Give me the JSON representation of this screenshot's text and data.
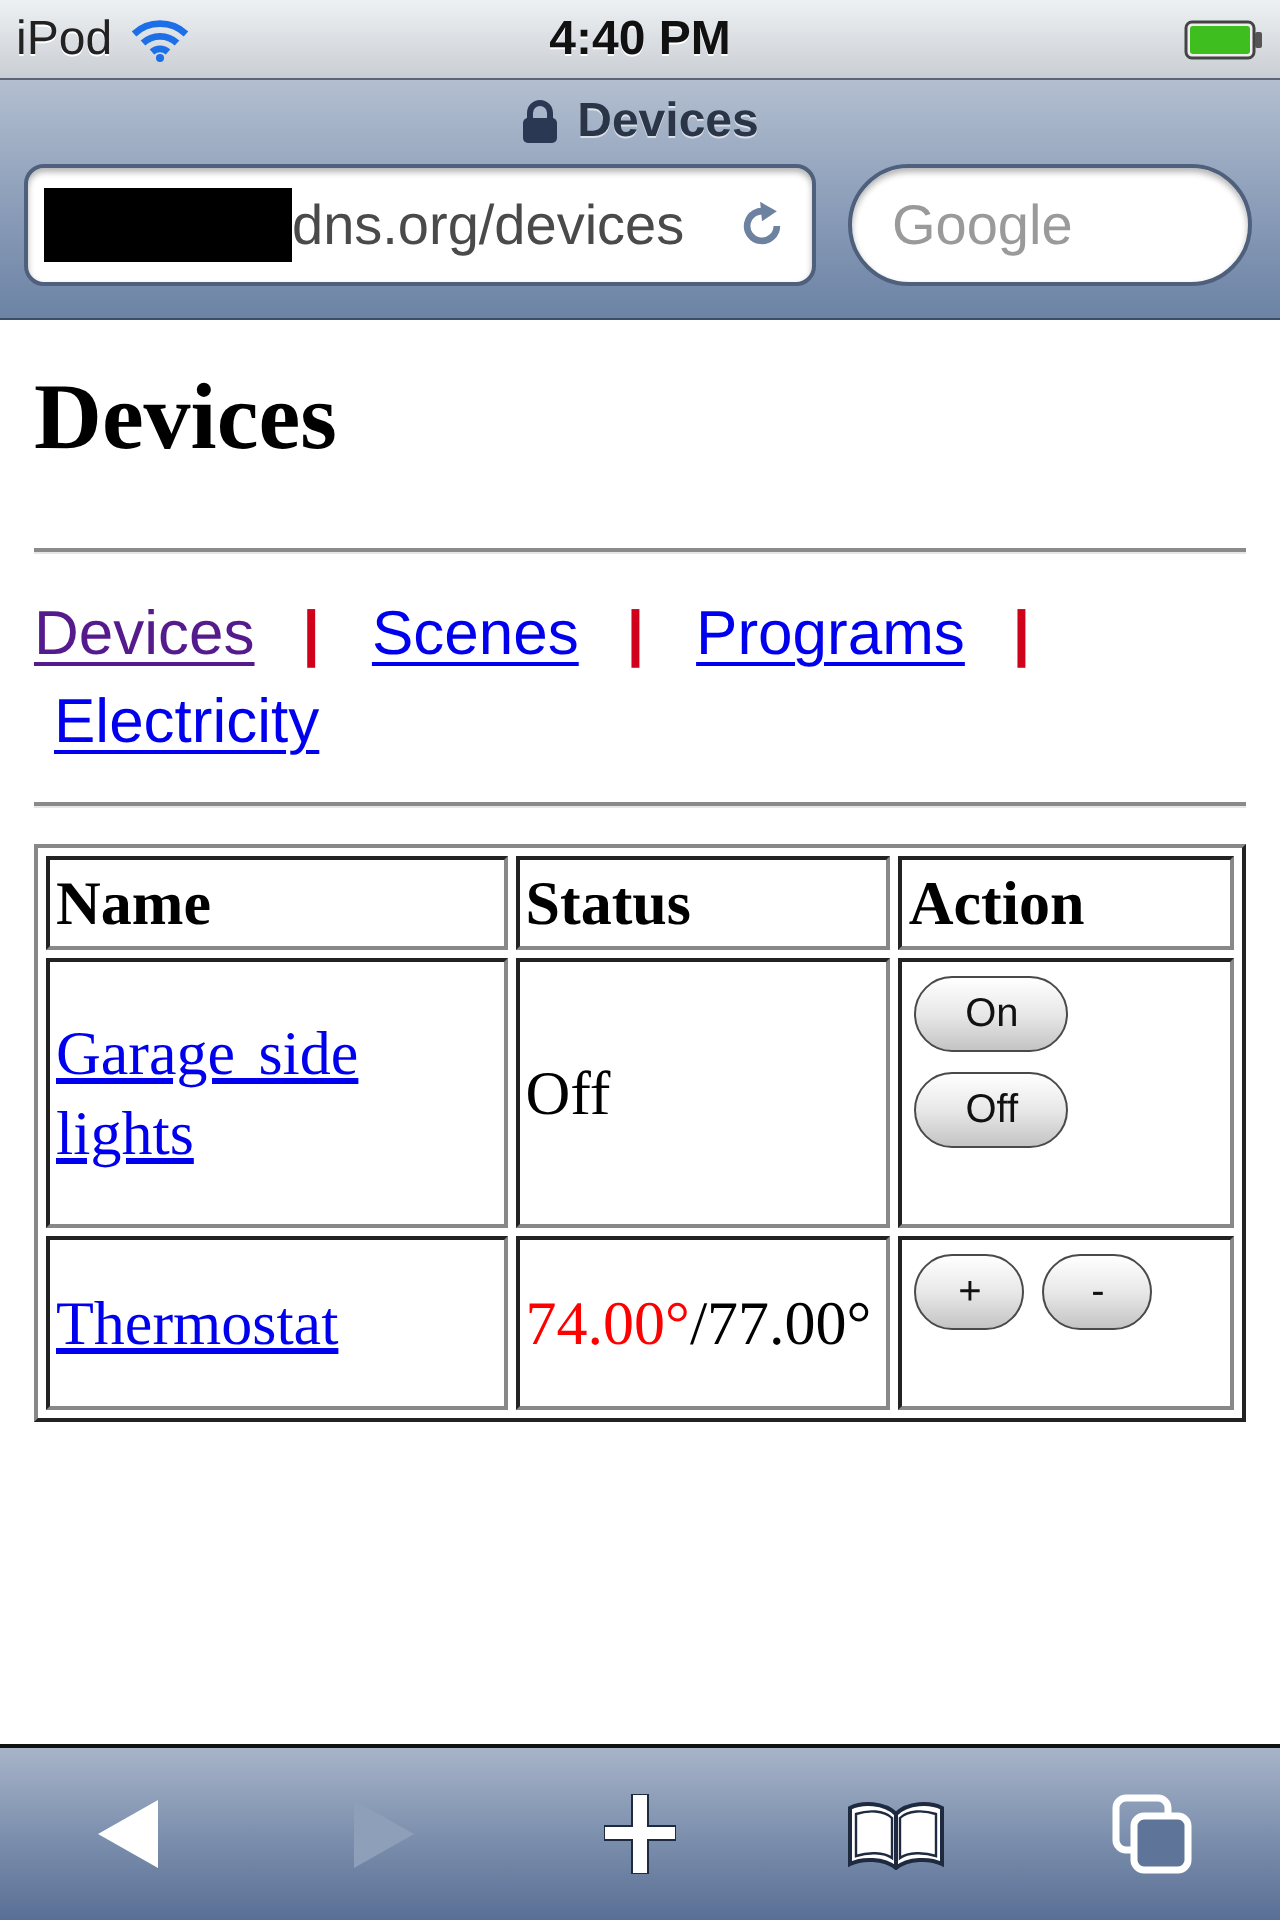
{
  "status_bar": {
    "carrier": "iPod",
    "time": "4:40 PM"
  },
  "browser": {
    "title": "Devices",
    "secure": true,
    "url_redacted": true,
    "url": "dns.org/devices",
    "search": {
      "placeholder": "Google"
    }
  },
  "page": {
    "heading": "Devices",
    "nav": [
      {
        "label": "Devices",
        "visited": true,
        "separator": "|"
      },
      {
        "label": "Scenes",
        "visited": false,
        "separator": "|"
      },
      {
        "label": "Programs",
        "visited": false,
        "separator": "|"
      },
      {
        "label": "Electricity",
        "visited": false
      }
    ],
    "table": {
      "columns": [
        "Name",
        "Status",
        "Action"
      ],
      "rows": [
        {
          "kind": "switch",
          "name": "Garage side lights",
          "status": [
            {
              "text": "Off",
              "color": "#000000"
            }
          ],
          "actions": [
            "On",
            "Off"
          ]
        },
        {
          "kind": "thermostat",
          "name": "Thermostat",
          "status": [
            {
              "text": "74.00°",
              "color": "#ff0000"
            },
            {
              "text": "/77.00°",
              "color": "#000000"
            }
          ],
          "actions": [
            "+",
            "-"
          ]
        }
      ]
    }
  },
  "toolbar": [
    {
      "kind": "back",
      "disabled": false
    },
    {
      "kind": "forward",
      "disabled": true
    },
    {
      "kind": "add",
      "disabled": false
    },
    {
      "kind": "bookmarks",
      "disabled": false
    },
    {
      "kind": "pages",
      "disabled": false
    }
  ]
}
